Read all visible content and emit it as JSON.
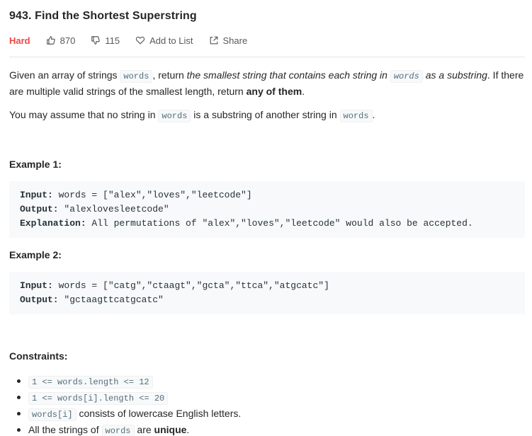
{
  "problem": {
    "title": "943. Find the Shortest Superstring",
    "difficulty": "Hard",
    "likes": "870",
    "dislikes": "115",
    "add_to_list": "Add to List",
    "share": "Share"
  },
  "description": {
    "p1_a": "Given an array of strings ",
    "p1_code1": "words",
    "p1_b": ", return ",
    "p1_em1": "the smallest string that contains each string in ",
    "p1_code2": "words",
    "p1_em2": " as a substring",
    "p1_c": ". If there are multiple valid strings of the smallest length, return ",
    "p1_bold": "any of them",
    "p1_d": ".",
    "p2_a": "You may assume that no string in ",
    "p2_code1": "words",
    "p2_b": " is a substring of another string in ",
    "p2_code2": "words",
    "p2_c": "."
  },
  "examples": [
    {
      "heading": "Example 1:",
      "input_label": "Input:",
      "input": " words = [\"alex\",\"loves\",\"leetcode\"]",
      "output_label": "Output:",
      "output": " \"alexlovesleetcode\"",
      "explanation_label": "Explanation:",
      "explanation": " All permutations of \"alex\",\"loves\",\"leetcode\" would also be accepted."
    },
    {
      "heading": "Example 2:",
      "input_label": "Input:",
      "input": " words = [\"catg\",\"ctaagt\",\"gcta\",\"ttca\",\"atgcatc\"]",
      "output_label": "Output:",
      "output": " \"gctaagttcatgcatc\""
    }
  ],
  "constraints": {
    "heading": "Constraints:",
    "c1_code": "1 <= words.length <= 12",
    "c2_code": "1 <= words[i].length <= 20",
    "c3_code": "words[i]",
    "c3_text": " consists of lowercase English letters.",
    "c4_a": "All the strings of ",
    "c4_code": "words",
    "c4_b": " are ",
    "c4_bold": "unique",
    "c4_c": "."
  },
  "icons": {
    "like": "thumbs-up-icon",
    "dislike": "thumbs-down-icon",
    "favorite": "heart-icon",
    "share": "share-icon"
  },
  "colors": {
    "hard": "#ef4743",
    "code_bg": "#f7f9fa"
  }
}
